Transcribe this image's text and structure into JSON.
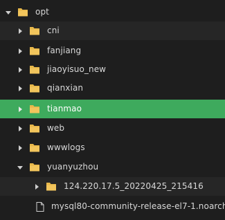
{
  "tree": {
    "colors": {
      "background": "#1e1e1e",
      "selected": "#3eaa5d",
      "folder": "#e8b84a",
      "text": "#d8d8d8"
    },
    "root": {
      "label": "opt",
      "icon": "folder-icon",
      "expanded": true
    },
    "children": [
      {
        "label": "cni",
        "icon": "folder-icon",
        "expanded": false
      },
      {
        "label": "fanjiang",
        "icon": "folder-icon",
        "expanded": false
      },
      {
        "label": "jiaoyisuo_new",
        "icon": "folder-icon",
        "expanded": false
      },
      {
        "label": "qianxian",
        "icon": "folder-icon",
        "expanded": false
      },
      {
        "label": "tianmao",
        "icon": "folder-icon",
        "expanded": false,
        "selected": true
      },
      {
        "label": "web",
        "icon": "folder-icon",
        "expanded": false
      },
      {
        "label": "wwwlogs",
        "icon": "folder-icon",
        "expanded": false
      },
      {
        "label": "yuanyuzhou",
        "icon": "folder-icon",
        "expanded": true,
        "children": [
          {
            "label": "124.220.17.5_20220425_215416",
            "icon": "folder-icon",
            "expanded": false
          },
          {
            "label": "mysql80-community-release-el7-1.noarch",
            "icon": "file-icon"
          }
        ]
      }
    ]
  }
}
